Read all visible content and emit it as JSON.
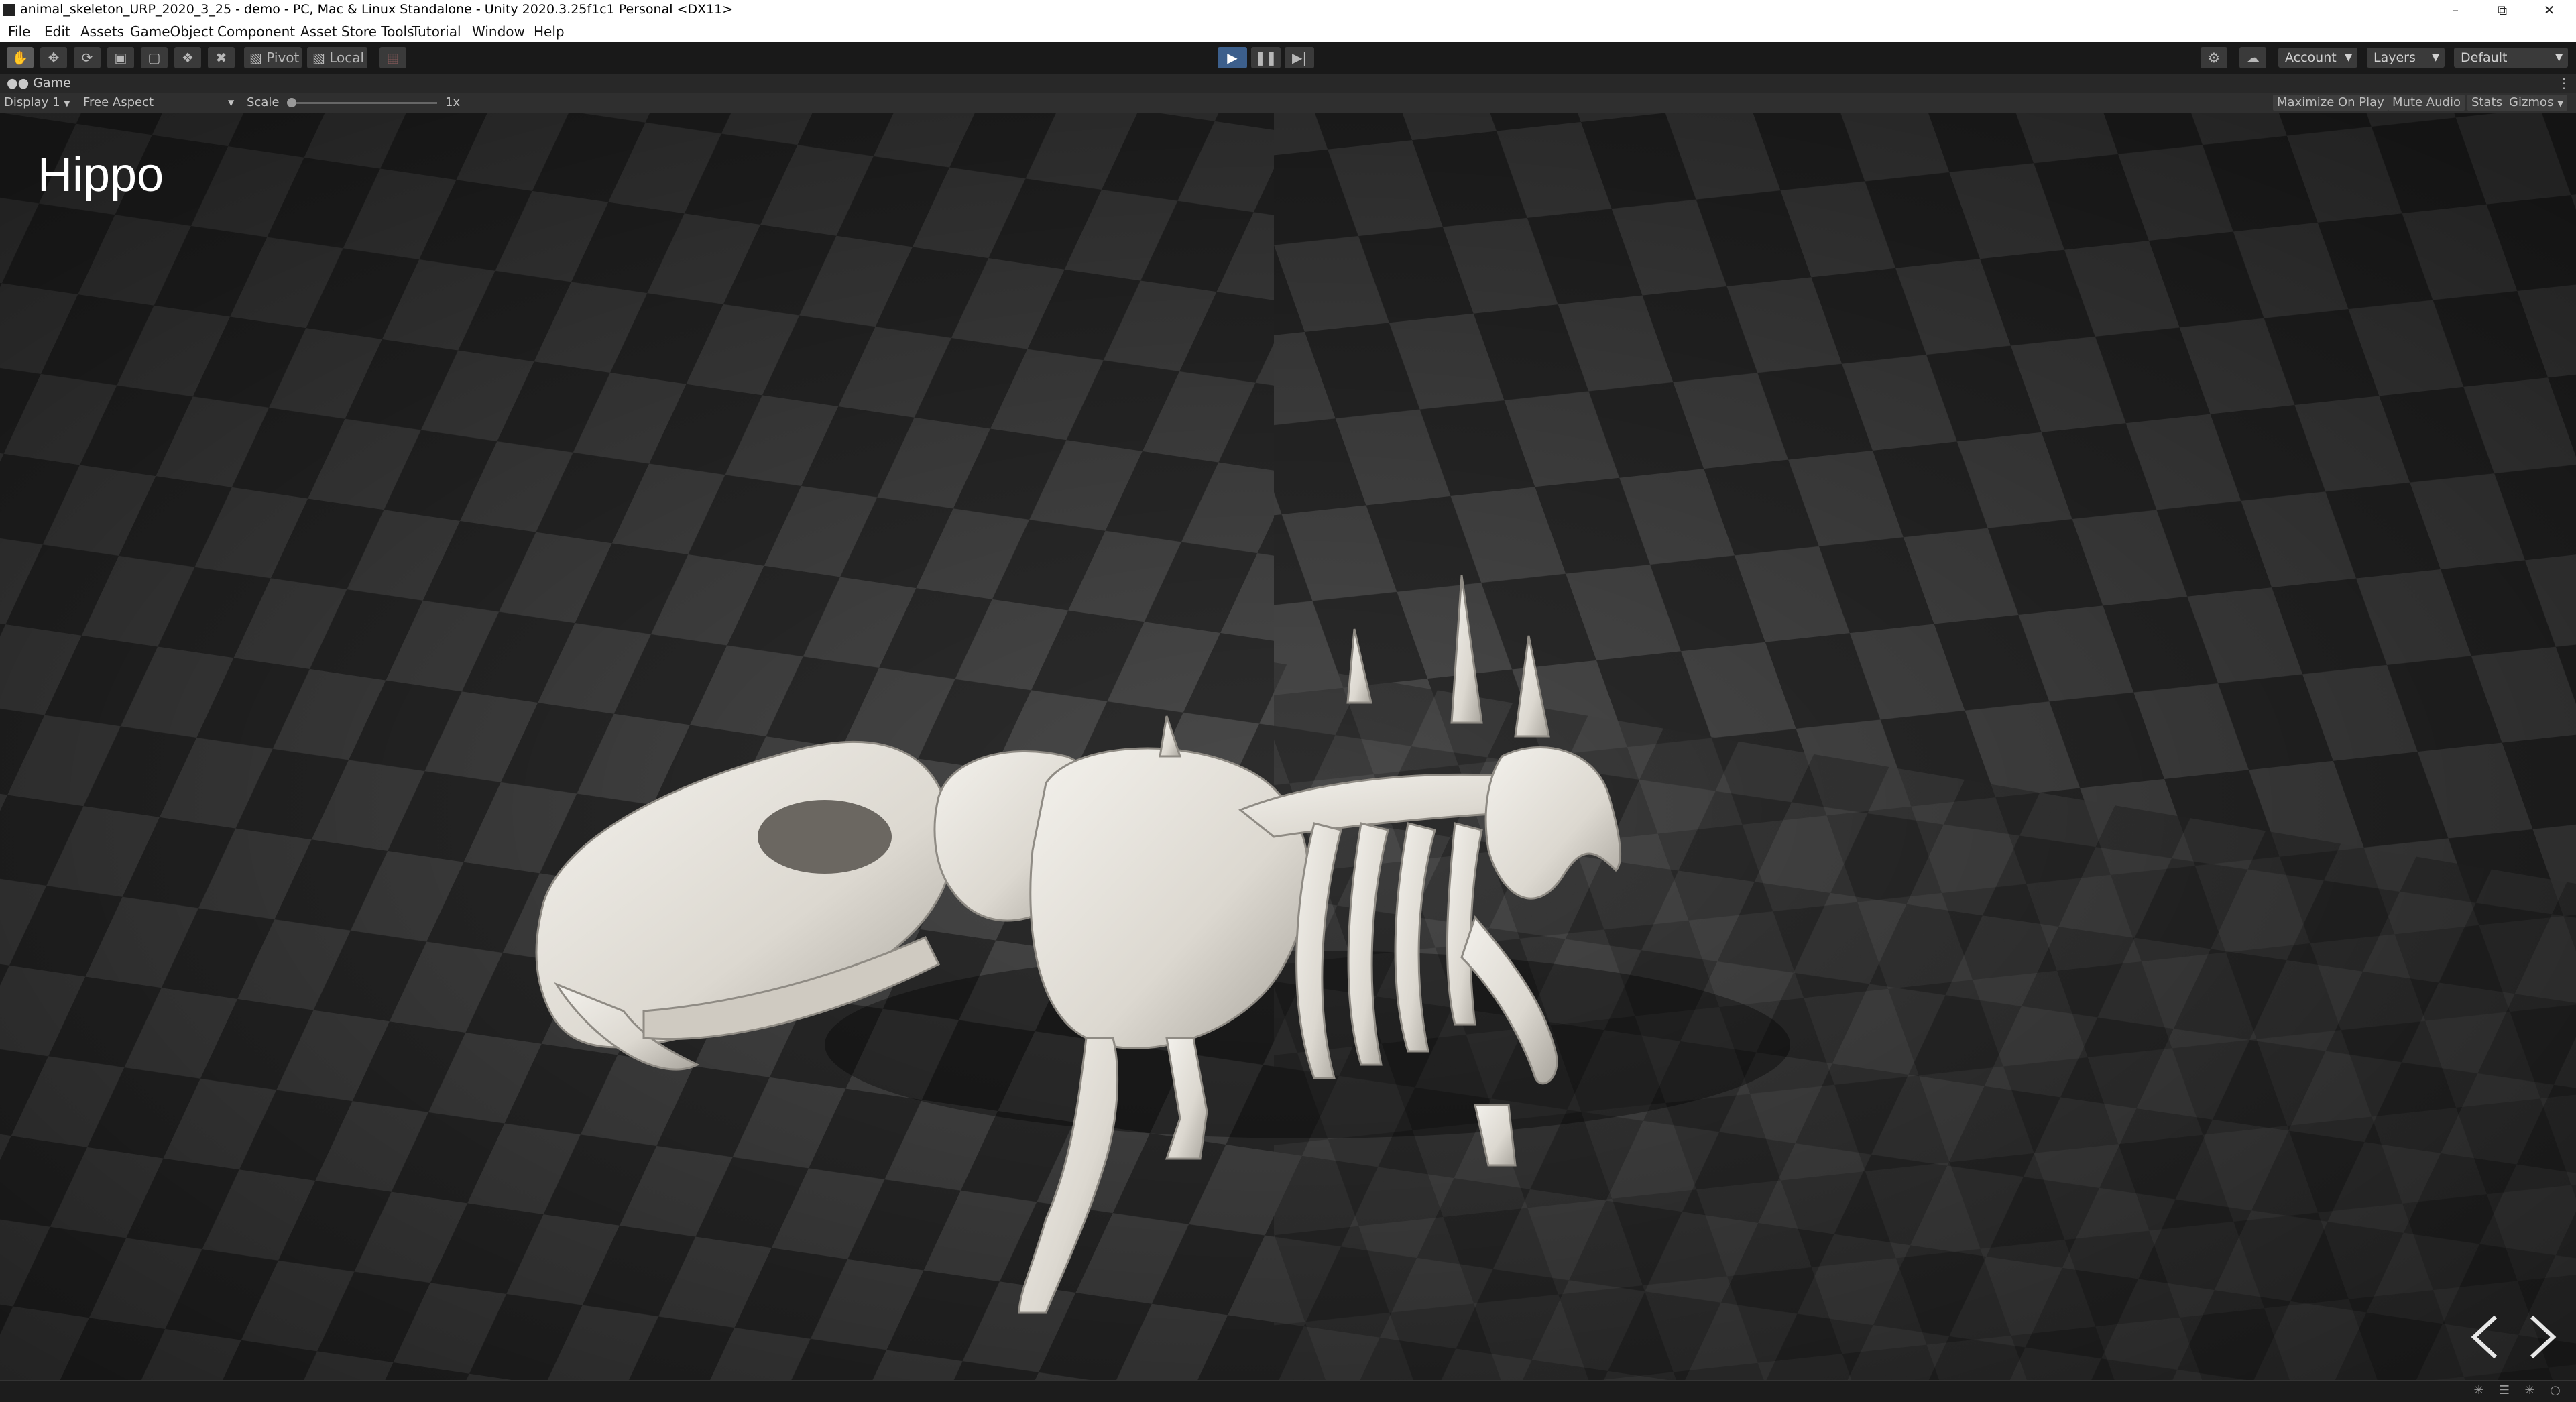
{
  "window": {
    "title": "animal_skeleton_URP_2020_3_25 - demo - PC, Mac & Linux Standalone - Unity 2020.3.25f1c1 Personal <DX11>"
  },
  "menu": [
    "File",
    "Edit",
    "Assets",
    "GameObject",
    "Component",
    "Asset Store Tools",
    "Tutorial",
    "Window",
    "Help"
  ],
  "toolbar": {
    "pivot_label": "Pivot",
    "local_label": "Local",
    "account_label": "Account",
    "layers_label": "Layers",
    "layout_label": "Default"
  },
  "game_view": {
    "tab_label": "Game",
    "display_label": "Display 1",
    "aspect_label": "Free Aspect",
    "scale_label": "Scale",
    "scale_value": "1x",
    "maximize_label": "Maximize On Play",
    "mute_label": "Mute Audio",
    "stats_label": "Stats",
    "gizmos_label": "Gizmos"
  },
  "scene": {
    "title": "Hippo"
  },
  "colors": {
    "play_active": "#3c5f8c",
    "editor_bg": "#191919",
    "bone": "#e6e3dc"
  },
  "icons": [
    "hand-tool-icon",
    "move-tool-icon",
    "rotate-tool-icon",
    "scale-tool-icon",
    "rect-tool-icon",
    "transform-tool-icon",
    "custom-tool-icon",
    "play-icon",
    "pause-icon",
    "step-icon",
    "cloud-icon",
    "collab-icon"
  ]
}
